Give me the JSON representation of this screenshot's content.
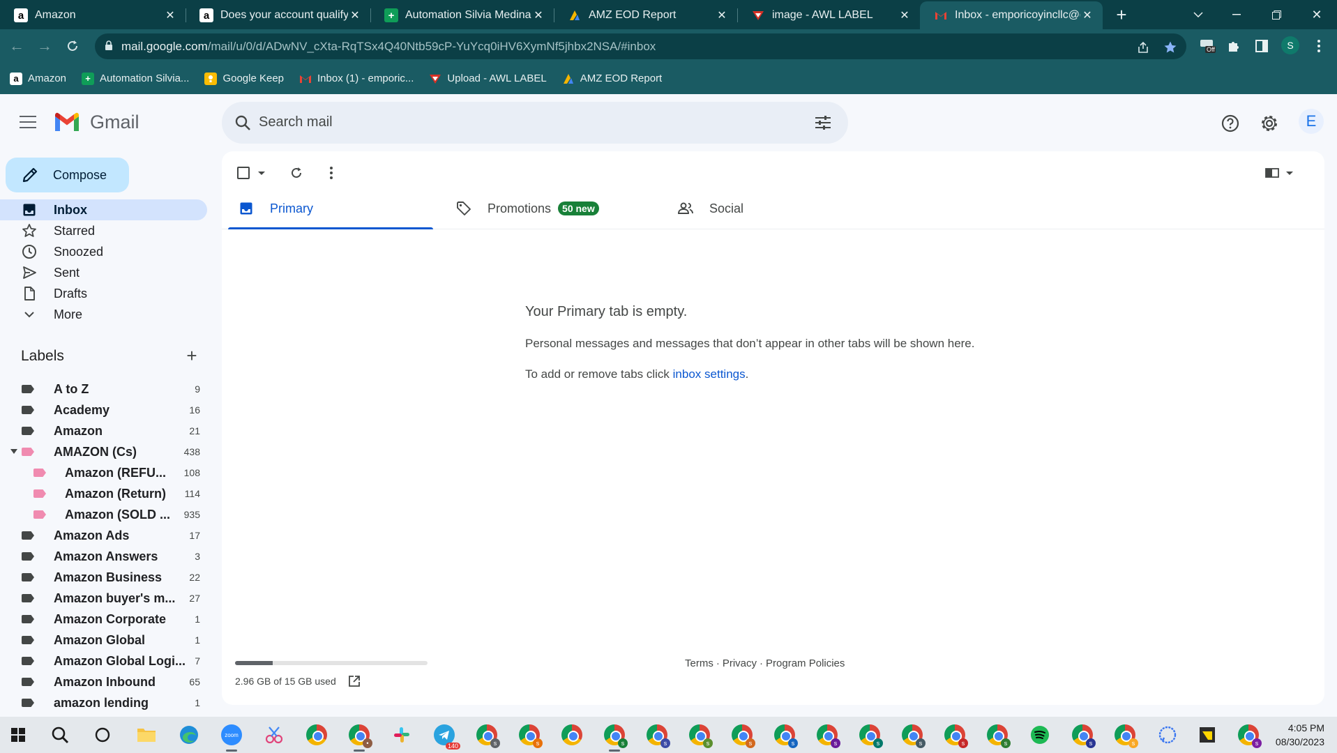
{
  "browser": {
    "tabs": [
      {
        "title": "Amazon",
        "favicon": "amazon-icon"
      },
      {
        "title": "Does your account qualify?",
        "favicon": "amazon-icon"
      },
      {
        "title": "Automation Silvia Medina -",
        "favicon": "sheets-icon"
      },
      {
        "title": "AMZ EOD Report",
        "favicon": "looker-icon"
      },
      {
        "title": "image - AWL LABEL",
        "favicon": "awl-icon"
      },
      {
        "title": "Inbox - emporicoyincllc@g",
        "favicon": "gmail-icon"
      }
    ],
    "url_host": "mail.google.com",
    "url_path": "/mail/u/0/d/ADwNV_cXta-RqTSx4Q40Ntb59cP-YuYcq0iHV6XymNf5jhbx2NSA/#inbox",
    "extension_badge": "Off",
    "profile_initial": "S",
    "bookmarks": [
      {
        "label": "Amazon",
        "favicon": "amazon-icon"
      },
      {
        "label": "Automation Silvia...",
        "favicon": "sheets-icon"
      },
      {
        "label": "Google Keep",
        "favicon": "keep-icon"
      },
      {
        "label": "Inbox (1) - emporic...",
        "favicon": "gmail-icon"
      },
      {
        "label": "Upload - AWL LABEL",
        "favicon": "awl-icon"
      },
      {
        "label": "AMZ EOD Report",
        "favicon": "looker-icon"
      }
    ]
  },
  "gmail": {
    "brand": "Gmail",
    "search_placeholder": "Search mail",
    "account_initial": "E",
    "compose_label": "Compose",
    "nav": [
      {
        "label": "Inbox",
        "icon": "inbox-icon",
        "active": true
      },
      {
        "label": "Starred",
        "icon": "star-icon"
      },
      {
        "label": "Snoozed",
        "icon": "clock-icon"
      },
      {
        "label": "Sent",
        "icon": "send-icon"
      },
      {
        "label": "Drafts",
        "icon": "draft-icon"
      },
      {
        "label": "More",
        "icon": "chevron-down-icon"
      }
    ],
    "labels_heading": "Labels",
    "labels": [
      {
        "name": "A to Z",
        "count": "9"
      },
      {
        "name": "Academy",
        "count": "16"
      },
      {
        "name": "Amazon",
        "count": "21"
      },
      {
        "name": "AMAZON (Cs)",
        "count": "438",
        "color": "#f08bb0",
        "expanded": true
      },
      {
        "name": "Amazon (REFU...",
        "count": "108",
        "color": "#f08bb0",
        "child": true
      },
      {
        "name": "Amazon (Return)",
        "count": "114",
        "color": "#f08bb0",
        "child": true
      },
      {
        "name": "Amazon (SOLD ...",
        "count": "935",
        "color": "#f08bb0",
        "child": true
      },
      {
        "name": "Amazon Ads",
        "count": "17"
      },
      {
        "name": "Amazon Answers",
        "count": "3"
      },
      {
        "name": "Amazon Business",
        "count": "22"
      },
      {
        "name": "Amazon buyer's m...",
        "count": "27"
      },
      {
        "name": "Amazon Corporate",
        "count": "1"
      },
      {
        "name": "Amazon Global",
        "count": "1"
      },
      {
        "name": "Amazon Global Logi...",
        "count": "7"
      },
      {
        "name": "Amazon Inbound",
        "count": "65"
      },
      {
        "name": "amazon lending",
        "count": "1"
      }
    ],
    "category_tabs": [
      {
        "label": "Primary",
        "icon": "inbox-tab-icon",
        "active": true
      },
      {
        "label": "Promotions",
        "icon": "tag-icon",
        "badge": "50 new"
      },
      {
        "label": "Social",
        "icon": "people-icon"
      }
    ],
    "empty": {
      "title": "Your Primary tab is empty.",
      "body": "Personal messages and messages that don’t appear in other tabs will be shown here.",
      "note_prefix": "To add or remove tabs click ",
      "note_link": "inbox settings",
      "note_suffix": "."
    },
    "storage": {
      "text": "2.96 GB of 15 GB used",
      "used_fraction": 0.197
    },
    "footer": [
      "Terms",
      "·",
      "Privacy",
      "·",
      "Program Policies"
    ]
  },
  "taskbar": {
    "time": "4:05 PM",
    "date": "08/30/2023",
    "telegram_badge": "140"
  },
  "colors": {
    "chrome_frame": "#0b3f46",
    "chrome_toolbar": "#1a5b63",
    "gmail_accent": "#0b57d0",
    "promotions_badge": "#188038",
    "pink_label": "#f08bb0"
  }
}
